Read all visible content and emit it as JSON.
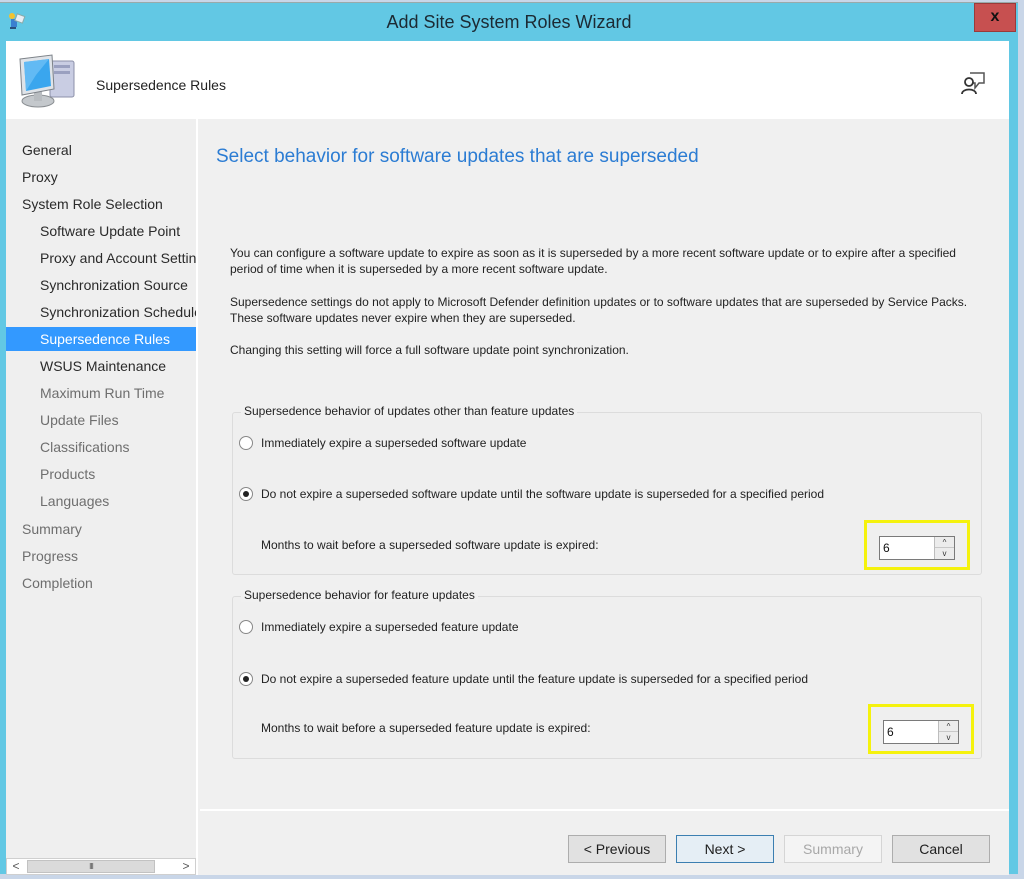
{
  "window": {
    "title": "Add Site System Roles Wizard",
    "close_label": "x"
  },
  "header": {
    "title": "Supersedence Rules"
  },
  "sidebar": {
    "items": [
      {
        "label": "General",
        "level": 1,
        "state": "done"
      },
      {
        "label": "Proxy",
        "level": 1,
        "state": "done"
      },
      {
        "label": "System Role Selection",
        "level": 1,
        "state": "done"
      },
      {
        "label": "Software Update Point",
        "level": 2,
        "state": "done"
      },
      {
        "label": "Proxy and Account Settings",
        "level": 2,
        "state": "done"
      },
      {
        "label": "Synchronization Source",
        "level": 2,
        "state": "done"
      },
      {
        "label": "Synchronization Schedule",
        "level": 2,
        "state": "done"
      },
      {
        "label": "Supersedence Rules",
        "level": 2,
        "state": "current"
      },
      {
        "label": "WSUS Maintenance",
        "level": 2,
        "state": "next"
      },
      {
        "label": "Maximum Run Time",
        "level": 2,
        "state": "pending"
      },
      {
        "label": "Update Files",
        "level": 2,
        "state": "pending"
      },
      {
        "label": "Classifications",
        "level": 2,
        "state": "pending"
      },
      {
        "label": "Products",
        "level": 2,
        "state": "pending"
      },
      {
        "label": "Languages",
        "level": 2,
        "state": "pending"
      },
      {
        "label": "Summary",
        "level": 1,
        "state": "pending"
      },
      {
        "label": "Progress",
        "level": 1,
        "state": "pending"
      },
      {
        "label": "Completion",
        "level": 1,
        "state": "pending"
      }
    ],
    "scroll_left": "<",
    "scroll_right": ">",
    "scroll_thumb": "III"
  },
  "main": {
    "heading": "Select behavior for software updates that are superseded",
    "paragraphs": [
      "You can configure a software update to expire as soon as it is superseded by a more recent software update or to expire after a specified period of time when it is superseded by a more recent software update.",
      "Supersedence settings do not apply to Microsoft Defender definition updates or to software updates that are superseded by Service Packs. These software updates never expire when they are superseded.",
      "Changing this setting will force a full software update point synchronization."
    ],
    "groups": [
      {
        "legend": "Supersedence behavior of updates other than feature updates",
        "option_immediate": "Immediately expire a superseded software update",
        "option_delay": "Do not expire a superseded software update until the software update is superseded for a specified period",
        "selected": "delay",
        "months_label": "Months to wait before a superseded software update is expired:",
        "months_value": "6"
      },
      {
        "legend": "Supersedence behavior for feature updates",
        "option_immediate": "Immediately expire a superseded feature update",
        "option_delay": "Do not expire a superseded feature update until the feature update is superseded for a specified period",
        "selected": "delay",
        "months_label": "Months to wait before a superseded feature update is expired:",
        "months_value": "6"
      }
    ],
    "spin_up": "^",
    "spin_down": "v",
    "highlight_color": "#f5f20d"
  },
  "footer": {
    "previous_label": "< Previous",
    "next_label": "Next >",
    "summary_label": "Summary",
    "cancel_label": "Cancel"
  },
  "colors": {
    "titlebar": "#62c8e4",
    "heading": "#2b7cd3",
    "selection": "#3399ff",
    "close": "#c75050"
  }
}
